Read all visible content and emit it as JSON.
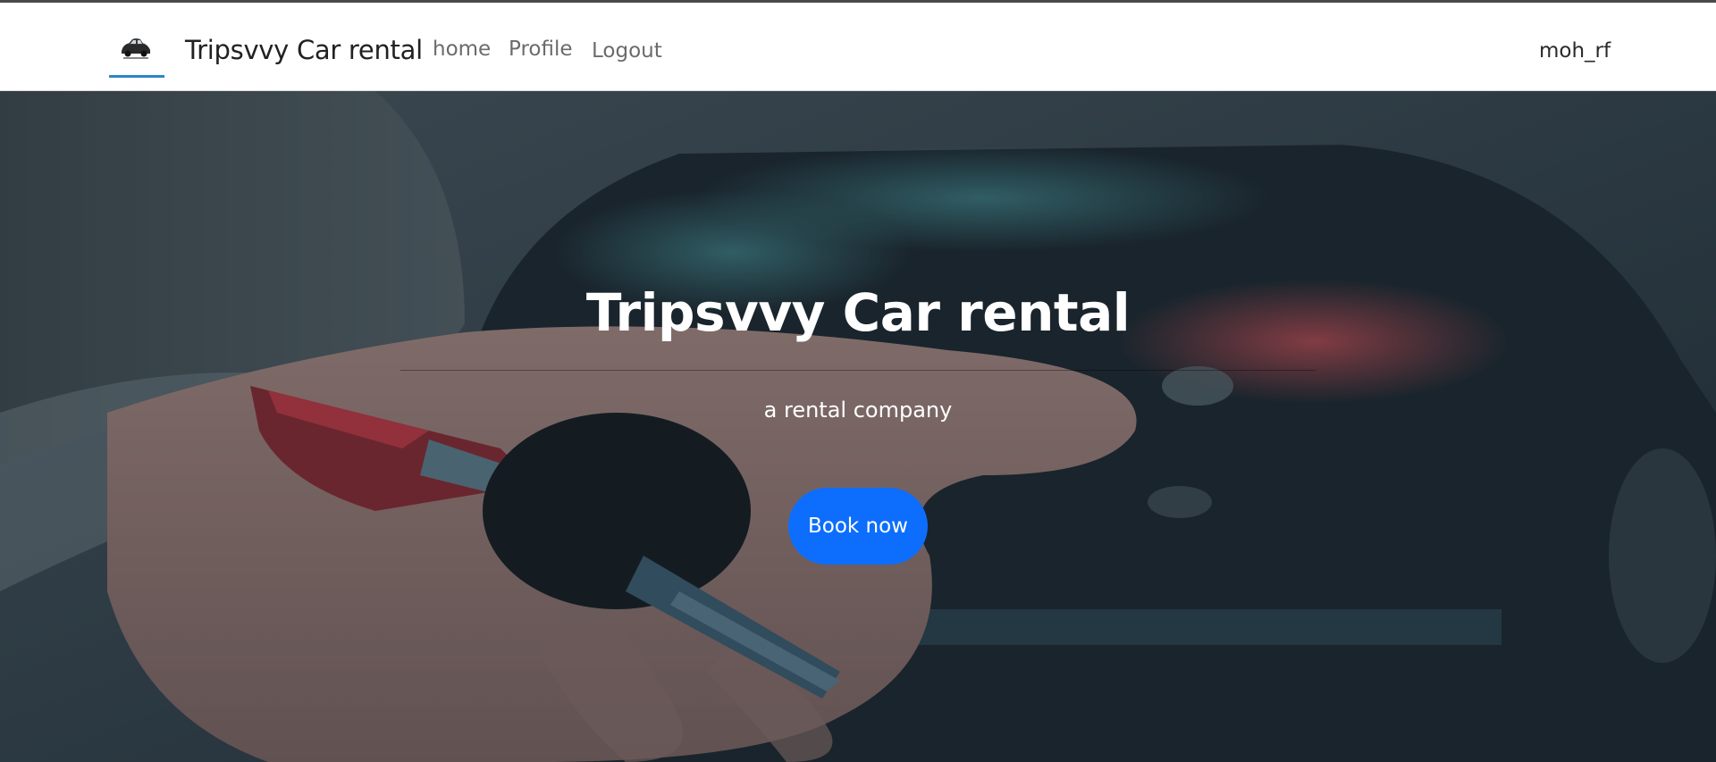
{
  "navbar": {
    "brand": "Tripsvvy Car rental",
    "links": [
      "home",
      "Profile",
      "Logout"
    ],
    "user": "moh_rf",
    "logo_icon": "car-icon",
    "accent_color": "#2b87c5"
  },
  "hero": {
    "title": "Tripsvvy Car rental",
    "subtitle": "a rental company",
    "cta_label": "Book now",
    "cta_color": "#0d6efd",
    "background": "hand-holding-car-keys-image"
  }
}
